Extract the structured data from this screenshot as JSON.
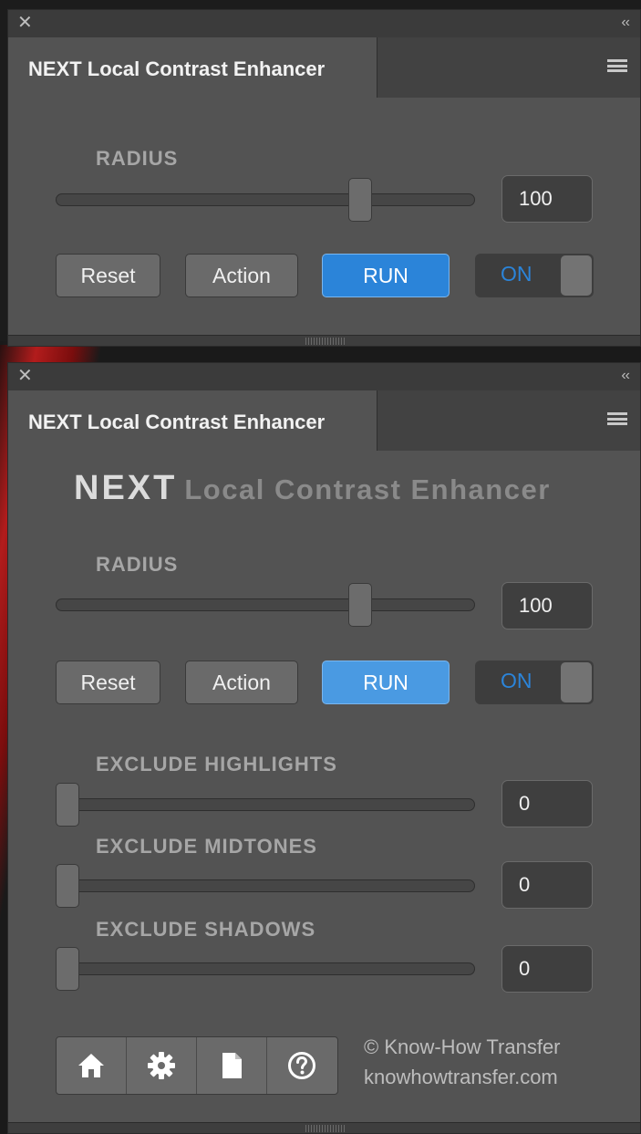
{
  "panel1": {
    "tab_title": "NEXT Local Contrast Enhancer",
    "radius": {
      "label": "RADIUS",
      "value": "100",
      "level": 0.74
    },
    "buttons": {
      "reset": "Reset",
      "action": "Action",
      "run": "RUN"
    },
    "toggle": {
      "label": "ON",
      "state": true
    }
  },
  "panel2": {
    "tab_title": "NEXT Local Contrast Enhancer",
    "brand": {
      "next": "NEXT",
      "rest": "Local Contrast Enhancer"
    },
    "radius": {
      "label": "RADIUS",
      "value": "100",
      "level": 0.74
    },
    "buttons": {
      "reset": "Reset",
      "action": "Action",
      "run": "RUN"
    },
    "toggle": {
      "label": "ON",
      "state": true
    },
    "exclude_highlights": {
      "label": "EXCLUDE HIGHLIGHTS",
      "value": "0",
      "level": 0
    },
    "exclude_midtones": {
      "label": "EXCLUDE MIDTONES",
      "value": "0",
      "level": 0
    },
    "exclude_shadows": {
      "label": "EXCLUDE SHADOWS",
      "value": "0",
      "level": 0
    },
    "footer": {
      "copyright": "© Know-How Transfer",
      "website": "knowhowtransfer.com"
    },
    "icons": [
      "home-icon",
      "gear-icon",
      "document-icon",
      "help-icon"
    ]
  },
  "colors": {
    "panel_bg": "#535353",
    "accent_blue": "#2b84d9",
    "title_bar": "#3b3b3b"
  }
}
